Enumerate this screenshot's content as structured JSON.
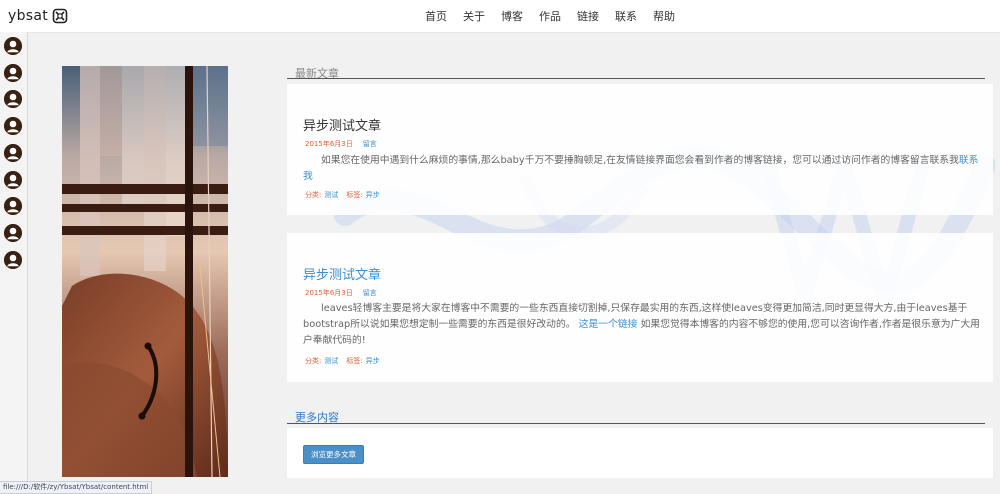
{
  "header": {
    "logo_text": "ybsat",
    "nav": [
      "首页",
      "关于",
      "博客",
      "作品",
      "链接",
      "联系",
      "帮助"
    ]
  },
  "avatars": {
    "count": 9
  },
  "latest": {
    "title": "最新文章"
  },
  "posts": [
    {
      "title": "异步测试文章",
      "date": "2015年6月3日",
      "comment": "留言",
      "body": "如果您在使用中遇到什么麻烦的事情,那么baby千万不要捶胸顿足,在友情链接界面您会看到作者的博客链接，您可以通过访问作者的博客留言联系我",
      "body_link": "联系我",
      "category_label": "分类:",
      "category": "测试",
      "tag_label": "标签:",
      "tag": "异步"
    },
    {
      "title": "异步测试文章",
      "date": "2015年6月3日",
      "comment": "留言",
      "body_part1": "leaves轻博客主要是将大家在博客中不需要的一些东西直接切割掉,只保存最实用的东西,这样使leaves变得更加简洁,同时更显得大方,由于leaves基于bootstrap所以说如果您想定制一些需要的东西是很好改动的。",
      "body_link": "这是一个链接",
      "body_part2": "如果您觉得本博客的内容不够您的使用,您可以咨询作者,作者是很乐意为广大用户奉献代码的!",
      "category_label": "分类:",
      "category": "测试",
      "tag_label": "标签:",
      "tag": "异步"
    }
  ],
  "more": {
    "title": "更多内容",
    "button": "浏览更多文章"
  },
  "status_url": "file:///D:/软件/zy/Ybsat/Ybsat/content.html",
  "colors": {
    "accent": "#3a8fd0",
    "date": "#e0603a",
    "button": "#4b8fc9"
  }
}
